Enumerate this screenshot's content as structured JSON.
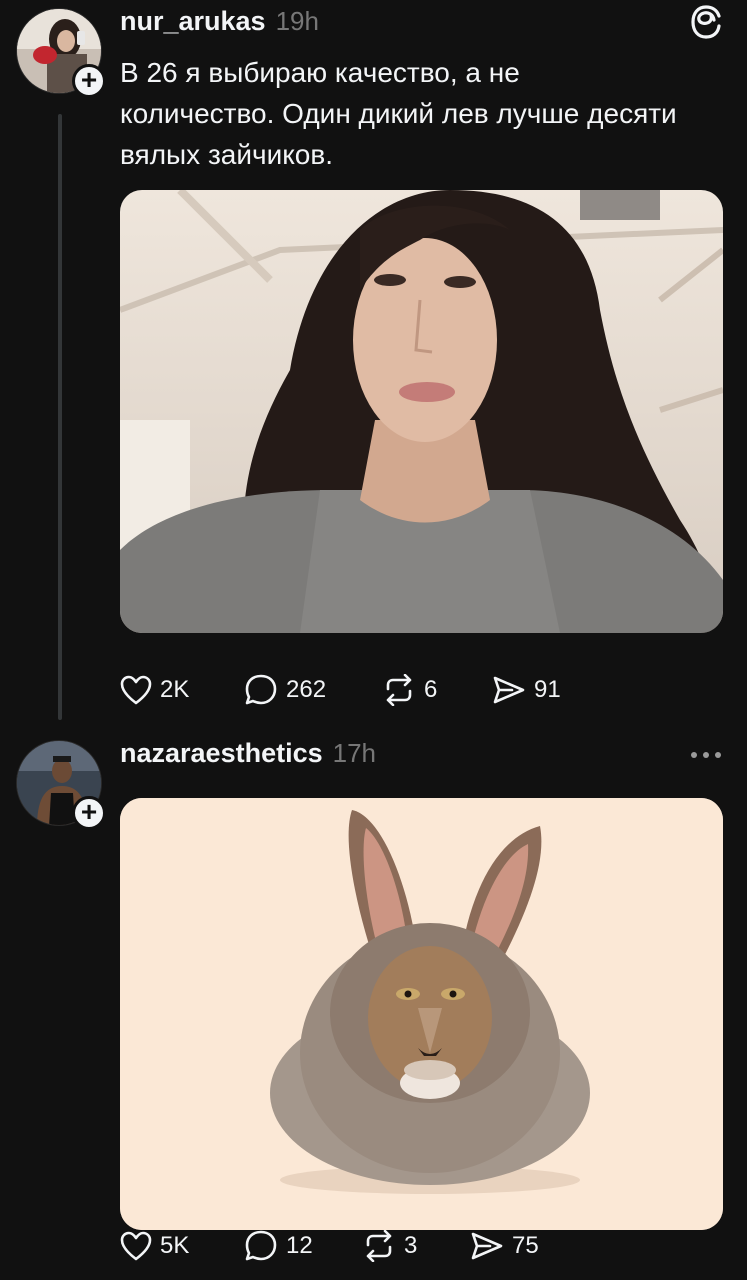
{
  "posts": [
    {
      "username": "nur_arukas",
      "time": "19h",
      "caption": "В 26 я выбираю качество, а не количество. Один дикий лев лучше десяти вялых зайчиков.",
      "actions": {
        "likes": "2K",
        "replies": "262",
        "reposts": "6",
        "shares": "91"
      },
      "media_icon": "selfie-photo"
    },
    {
      "username": "nazaraesthetics",
      "time": "17h",
      "actions": {
        "likes": "5K",
        "replies": "12",
        "reposts": "3",
        "shares": "75"
      },
      "media_icon": "lion-rabbit-photo"
    }
  ],
  "icons": [
    "threads-logo-icon",
    "plus-icon",
    "heart-icon",
    "comment-icon",
    "repost-icon",
    "share-icon",
    "more-icon"
  ],
  "colors": {
    "background": "#111111",
    "text": "#f3f5f7",
    "muted": "#777777",
    "thread_line": "#333638",
    "photo2_bg": "#fbe8d6"
  }
}
